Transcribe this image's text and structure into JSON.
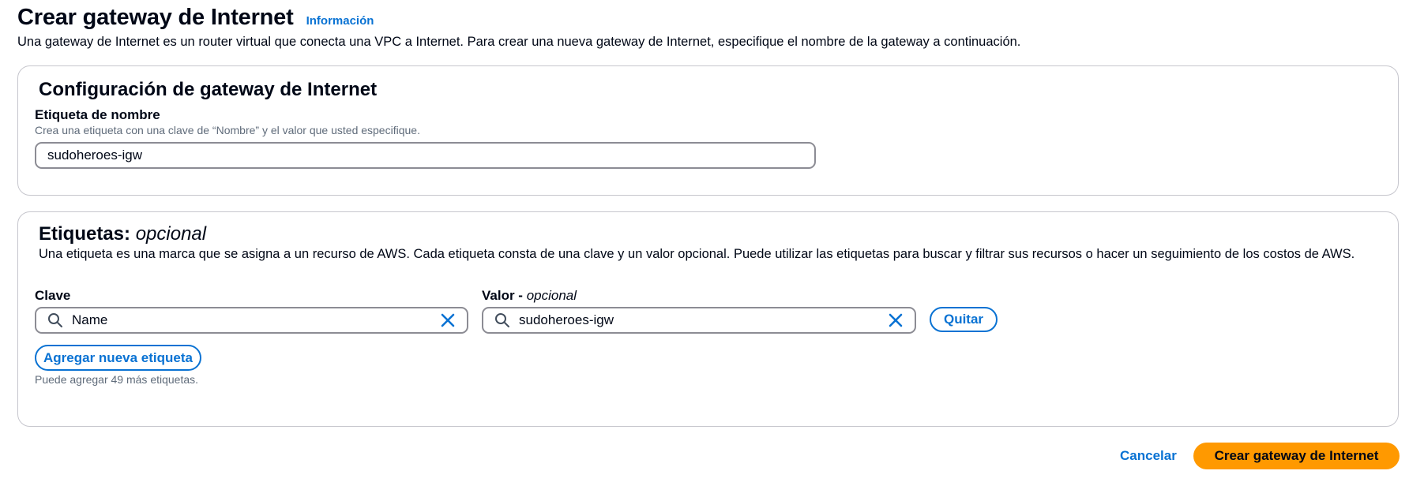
{
  "header": {
    "title": "Crear gateway de Internet",
    "info_link": "Información",
    "description": "Una gateway de Internet es un router virtual que conecta una VPC a Internet. Para crear una nueva gateway de Internet, especifique el nombre de la gateway a continuación."
  },
  "config_panel": {
    "heading": "Configuración de gateway de Internet",
    "name_tag": {
      "label": "Etiqueta de nombre",
      "description": "Crea una etiqueta con una clave de “Nombre” y el valor que usted especifique.",
      "value": "sudoheroes-igw"
    }
  },
  "tags_panel": {
    "heading": "Etiquetas:",
    "heading_optional": "opcional",
    "description": "Una etiqueta es una marca que se asigna a un recurso de AWS. Cada etiqueta consta de una clave y un valor opcional. Puede utilizar las etiquetas para buscar y filtrar sus recursos o hacer un seguimiento de los costos de AWS.",
    "key_label": "Clave",
    "value_label": "Valor -",
    "value_label_optional": "opcional",
    "tags": [
      {
        "key": "Name",
        "value": "sudoheroes-igw",
        "remove_label": "Quitar"
      }
    ],
    "add_button": "Agregar nueva etiqueta",
    "remaining_note": "Puede agregar 49 más etiquetas."
  },
  "footer": {
    "cancel_label": "Cancelar",
    "submit_label": "Crear gateway de Internet"
  },
  "colors": {
    "accent": "#0972d3",
    "primary_button": "#ff9900",
    "text": "#000716",
    "muted_text": "#5f6b7a",
    "border": "#c6c6cd"
  },
  "icons": {
    "search": "search-icon",
    "clear": "close-icon"
  }
}
